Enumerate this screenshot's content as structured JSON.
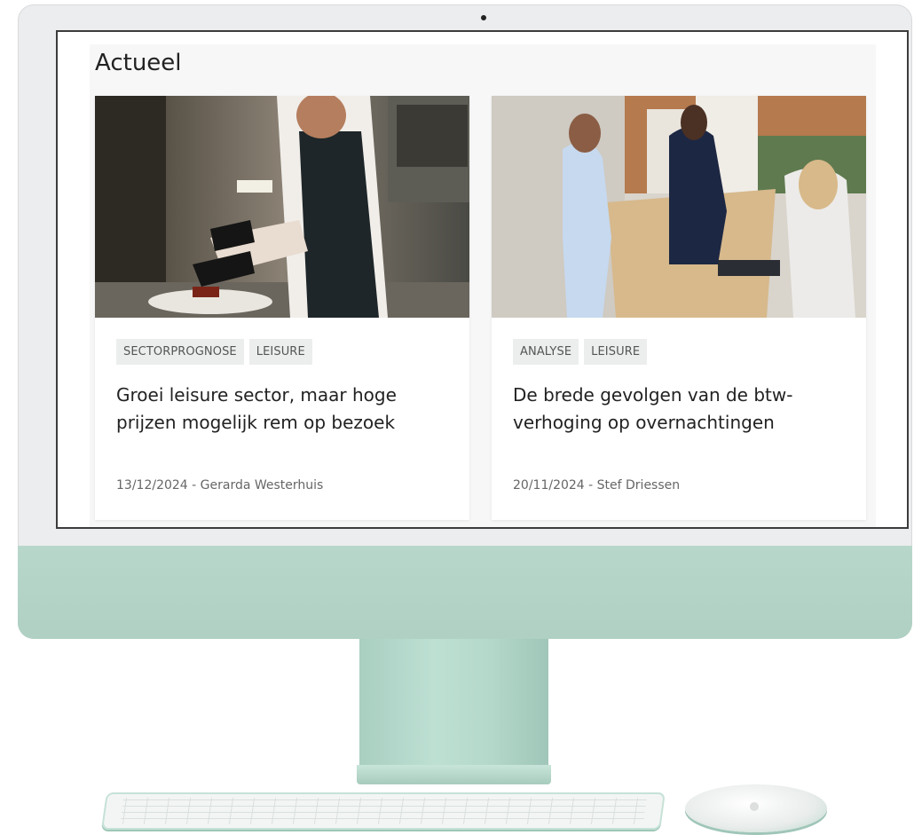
{
  "page": {
    "title": "Actueel"
  },
  "articles": [
    {
      "tags": [
        "SECTORPROGNOSE",
        "LEISURE"
      ],
      "title": "Groei leisure sector, maar hoge prijzen mogelijk rem op bezoek",
      "meta": "13/12/2024 - Gerarda Westerhuis",
      "image": "chef-plating-food-photo"
    },
    {
      "tags": [
        "ANALYSE",
        "LEISURE"
      ],
      "title": "De brede gevolgen van de btw-verhoging op overnachtingen",
      "meta": "20/11/2024 - Stef Driessen",
      "image": "hotel-reception-photo"
    }
  ],
  "colors": {
    "device_accent": "#b4d6c9",
    "tag_bg": "#eceeee"
  }
}
